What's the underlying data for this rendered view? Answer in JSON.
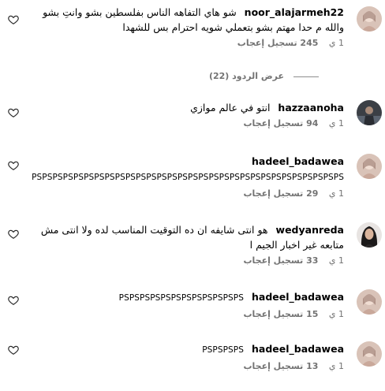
{
  "comments": [
    {
      "username": "noor_alajarmeh22",
      "text": "شو هاي التفاهه الناس بفلسطين بشو وانتِ بشو والله م حدا مهتم بشو بتعملي شويه احترام بس للشهدا",
      "time": "1 ي",
      "likes": "245 تسجيل إعجاب",
      "reply": "",
      "avatar": "woman-avatar"
    },
    {
      "username": "hazzaanoha",
      "text": "انتو في عالم موازي",
      "time": "1 ي",
      "likes": "94 تسجيل إعجاب",
      "reply": "",
      "avatar": "dark-avatar"
    },
    {
      "username": "hadeel_badawea",
      "text": "PSPSPSPSPSPSPSPSPSPSPSPSPSPSPSPSPSPSPSPSPSPSPSPSPSPSPSPSPSPS",
      "time": "1 ي",
      "likes": "29 تسجيل إعجاب",
      "reply": "",
      "avatar": "woman-avatar"
    },
    {
      "username": "wedyanreda",
      "text": "هو انتى شايفه ان ده التوقيت المناسب لده ولا انتى مش متابعه غير اخبار الجيم ا",
      "time": "1 ي",
      "likes": "33 تسجيل إعجاب",
      "reply": "",
      "avatar": "dark-hair-avatar"
    },
    {
      "username": "hadeel_badawea",
      "text": "PSPSPSPSPSPSPSPSPSPSPSPS",
      "time": "1 ي",
      "likes": "15 تسجيل إعجاب",
      "reply": "",
      "avatar": "woman-avatar"
    },
    {
      "username": "hadeel_badawea",
      "text": "PSPSPSPS",
      "time": "1 ي",
      "likes": "13 تسجيل إعجاب",
      "reply": "",
      "avatar": "woman-avatar"
    }
  ],
  "view_replies_label": "عرض الردود (22)",
  "icons": {
    "like": "heart-outline-icon"
  },
  "colors": {
    "text": "#000000",
    "meta": "#737373",
    "background": "#ffffff"
  }
}
